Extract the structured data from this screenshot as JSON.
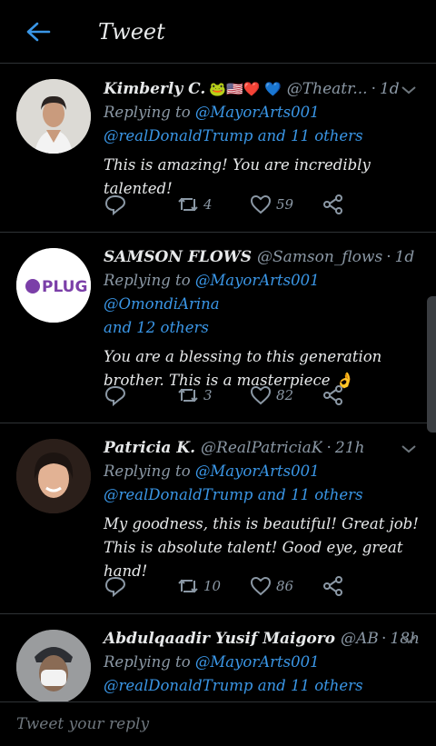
{
  "header": {
    "title": "Tweet"
  },
  "tweets": [
    {
      "name": "Kimberly C.",
      "emojis": "🐸🇺🇸❤️ 💙",
      "handle": "@Theatr...",
      "time": "1d",
      "replying_label": "Replying to",
      "mention1": "@MayorArts001",
      "mention2": "@realDonaldTrump",
      "others": "and 11 others",
      "text": "This is amazing! You are incredibly talented!",
      "retweets": "4",
      "likes": "59"
    },
    {
      "name": "SAMSON FLOWS",
      "handle": "@Samson_flows",
      "time": "1d",
      "replying_label": "Replying to",
      "mention1": "@MayorArts001",
      "mention2": "@OmondiArina",
      "others": "and 12 others",
      "text": "You are a blessing to this generation brother. This is a masterpiece 👌",
      "retweets": "3",
      "likes": "82",
      "avatar_text": "PLUG"
    },
    {
      "name": "Patricia K.",
      "handle": "@RealPatriciaK",
      "time": "21h",
      "replying_label": "Replying to",
      "mention1": "@MayorArts001",
      "mention2": "@realDonaldTrump",
      "others": "and 11 others",
      "text": "My goodness, this is beautiful! Great job! This is absolute talent! Good eye, great hand!",
      "retweets": "10",
      "likes": "86"
    },
    {
      "name": "Abdulqaadir Yusif Maigoro",
      "handle": "@ABD...",
      "time": "18h",
      "replying_label": "Replying to",
      "mention1": "@MayorArts001",
      "mention2": "@realDonaldTrump",
      "others": "and 11 others"
    }
  ],
  "reply_bar": {
    "placeholder": "Tweet your reply"
  },
  "colors": {
    "background": "#000000",
    "accent": "#3a96e6",
    "muted": "#8b98a5",
    "divider": "#2f3336"
  }
}
